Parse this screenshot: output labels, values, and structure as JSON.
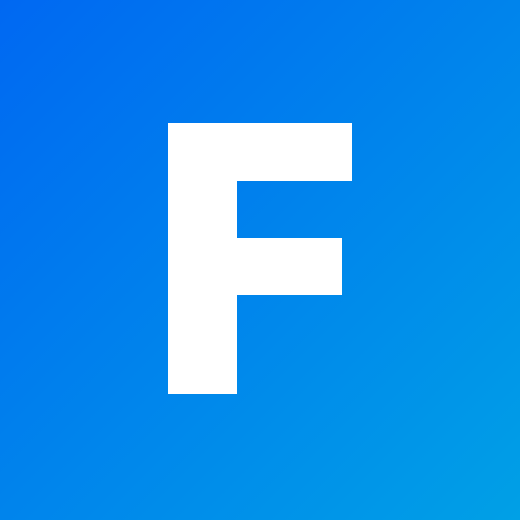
{
  "icon": {
    "name": "letter-f-logo-icon",
    "lettering": "F",
    "colors": {
      "background_start": "#0068f2",
      "background_end": "#00a0e6",
      "glyph": "#ffffff"
    }
  }
}
